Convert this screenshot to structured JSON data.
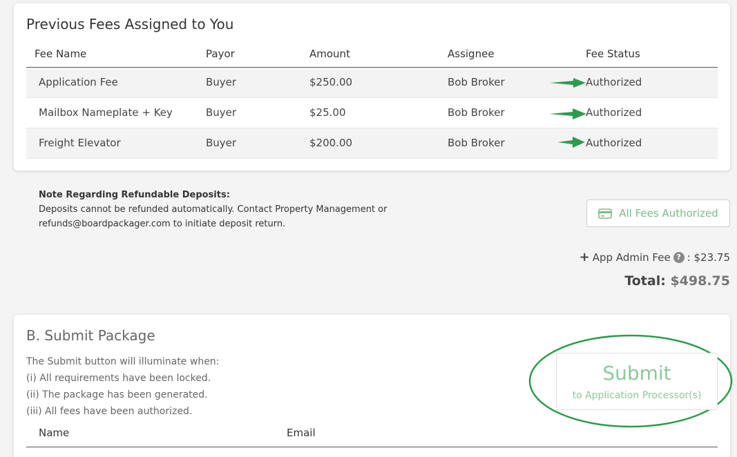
{
  "fees_card": {
    "title": "Previous Fees Assigned to You",
    "columns": [
      "Fee Name",
      "Payor",
      "Amount",
      "Assignee",
      "Fee Status"
    ],
    "rows": [
      {
        "name": "Application Fee",
        "payor": "Buyer",
        "amount": "$250.00",
        "assignee": "Bob Broker",
        "status": "Authorized"
      },
      {
        "name": "Mailbox Nameplate + Key",
        "payor": "Buyer",
        "amount": "$25.00",
        "assignee": "Bob Broker",
        "status": "Authorized"
      },
      {
        "name": "Freight Elevator",
        "payor": "Buyer",
        "amount": "$200.00",
        "assignee": "Bob Broker",
        "status": "Authorized"
      }
    ]
  },
  "note": {
    "title": "Note Regarding Refundable Deposits:",
    "line1": "Deposits cannot be refunded automatically. Contact Property Management or",
    "line2": "refunds@boardpackager.com to initiate deposit return."
  },
  "fees_button": {
    "label": "All Fees Authorized",
    "icon": "credit-card-icon"
  },
  "admin_fee": {
    "prefix": "+",
    "label": "App Admin Fee",
    "help": "?",
    "value": ": $23.75"
  },
  "total": {
    "label": "Total:",
    "value": "$498.75"
  },
  "submit_card": {
    "title": "B. Submit Package",
    "requirements": [
      "The Submit button will illuminate when:",
      "(i) All requirements have been locked.",
      "(ii) The package has been generated.",
      "(iii) All fees have been authorized."
    ],
    "submit_label": "Submit",
    "submit_sub": "to Application Processor(s)",
    "columns": [
      "Name",
      "Email"
    ]
  },
  "colors": {
    "arrow": "#2e9a4e",
    "ellipse": "#2e9a4e",
    "accent_green": "#7fb98a"
  }
}
